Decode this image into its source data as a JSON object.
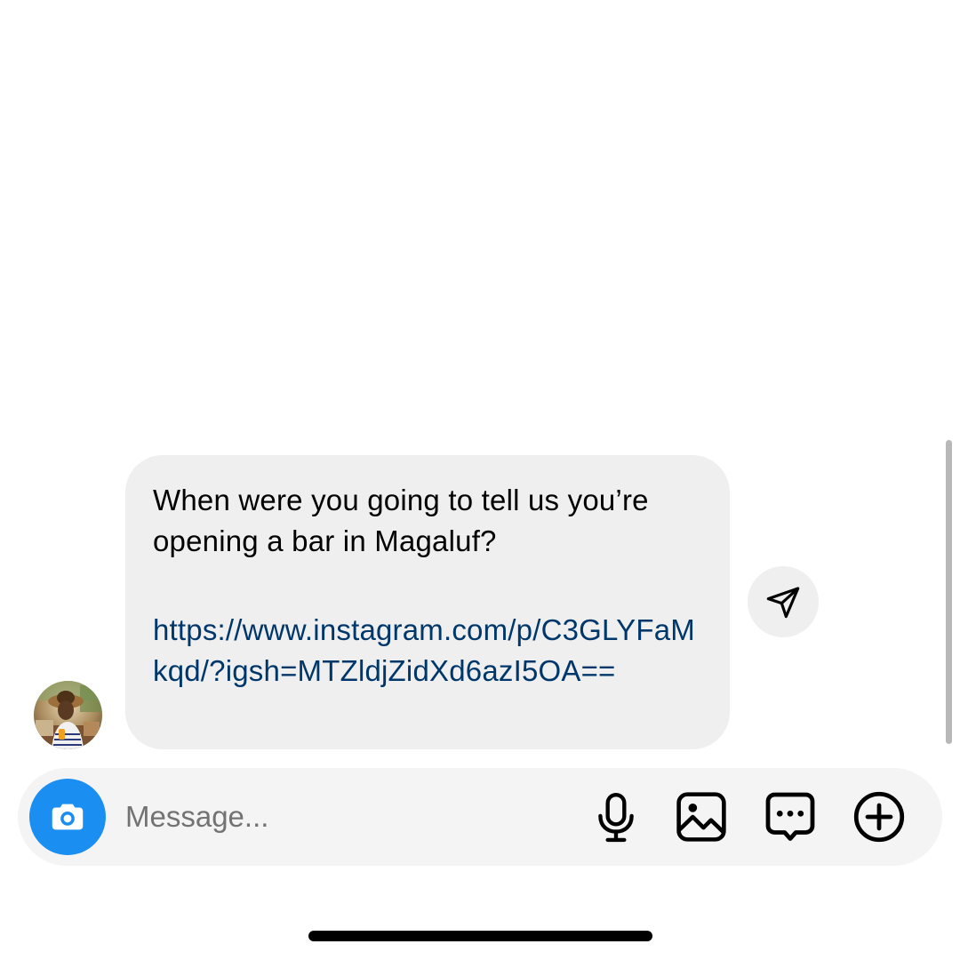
{
  "thread": {
    "messages": [
      {
        "sender_avatar": "avatar-photo",
        "text": "When were you going to tell us you’re opening a bar in Magaluf?",
        "link": "https://www.instagram.com/p/C3GLYFaMkqd/?igsh=MTZldjZidXd6azI5OA=="
      }
    ]
  },
  "composer": {
    "placeholder": "Message...",
    "value": "",
    "icons": {
      "camera": "camera-icon",
      "microphone": "microphone-icon",
      "gallery": "gallery-icon",
      "sticker": "sticker-chat-icon",
      "add": "plus-circle-icon"
    }
  },
  "colors": {
    "accent": "#1b8ef2",
    "bubble": "#efefef",
    "link": "#00376b",
    "composer_bg": "#f4f4f4"
  }
}
